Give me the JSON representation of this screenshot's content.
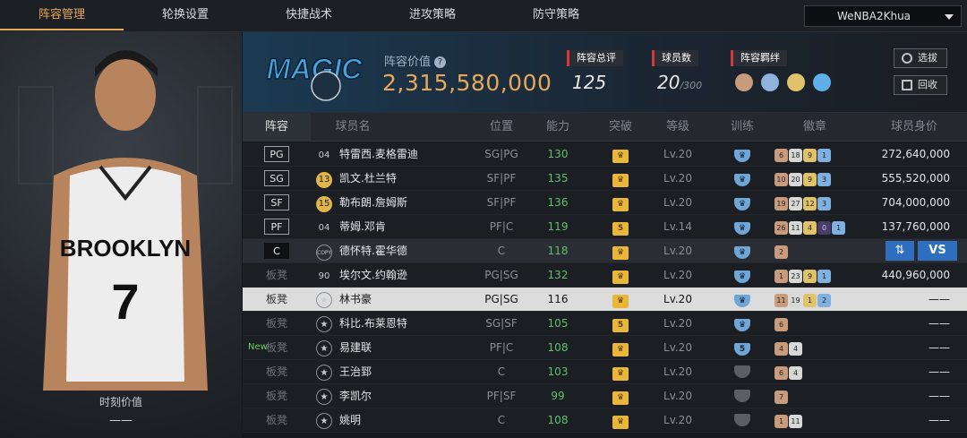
{
  "tabs": [
    {
      "label": "阵容管理",
      "active": true
    },
    {
      "label": "轮换设置",
      "active": false
    },
    {
      "label": "快捷战术",
      "active": false
    },
    {
      "label": "进攻策略",
      "active": false
    },
    {
      "label": "防守策略",
      "active": false
    }
  ],
  "user": {
    "name": "WeNBA2Khua"
  },
  "left_panel": {
    "value_caption": "时刻价值",
    "value": "——"
  },
  "header": {
    "value_caption": "阵容价值",
    "value": "2,315,580,000",
    "overall_label": "阵容总评",
    "overall": "125",
    "count_label": "球员数",
    "count": "20",
    "count_max": "/300",
    "chem_label": "阵容羁绊",
    "select_button": "选拔",
    "recycle_button": "回收"
  },
  "columns": [
    "阵容",
    "球员名",
    "位置",
    "能力",
    "突破",
    "等级",
    "训练",
    "徽章",
    "球员身价"
  ],
  "rows": [
    {
      "slot": "PG",
      "num": "04",
      "name": "特雷西.麦格雷迪",
      "pos": "SG|PG",
      "ability": "130",
      "break": "crown",
      "level": "Lv.20",
      "train": "shield",
      "badges": [
        [
          "b-br",
          "6"
        ],
        [
          "b-si",
          "18"
        ],
        [
          "b-go",
          "9"
        ],
        [
          "b-bl",
          "1"
        ]
      ],
      "value": "272,640,000"
    },
    {
      "slot": "SG",
      "num": "13",
      "name": "凯文.杜兰特",
      "pos": "SF|PF",
      "ability": "135",
      "break": "crown",
      "level": "Lv.20",
      "train": "shield",
      "badges": [
        [
          "b-br",
          "10"
        ],
        [
          "b-si",
          "20"
        ],
        [
          "b-go",
          "9"
        ],
        [
          "b-bl",
          "3"
        ]
      ],
      "value": "555,520,000"
    },
    {
      "slot": "SF",
      "num": "15",
      "name": "勒布朗.詹姆斯",
      "pos": "SF|PF",
      "ability": "136",
      "break": "crown",
      "level": "Lv.20",
      "train": "shield",
      "badges": [
        [
          "b-br",
          "19"
        ],
        [
          "b-si",
          "27"
        ],
        [
          "b-go",
          "12"
        ],
        [
          "b-bl",
          "3"
        ]
      ],
      "value": "704,000,000"
    },
    {
      "slot": "PF",
      "num": "04",
      "name": "蒂姆.邓肯",
      "pos": "PF|C",
      "ability": "119",
      "break": "5",
      "level": "Lv.14",
      "train": "shield",
      "badges": [
        [
          "b-br",
          "26"
        ],
        [
          "b-si",
          "11"
        ],
        [
          "b-go",
          "4"
        ],
        [
          "b-pu",
          "0"
        ],
        [
          "b-bl",
          "1"
        ]
      ],
      "value": "137,760,000"
    },
    {
      "slot": "C",
      "num": "COPY",
      "name": "德怀特.霍华德",
      "pos": "C",
      "ability": "118",
      "break": "crown",
      "level": "Lv.20",
      "train": "shield",
      "badges": [
        [
          "b-br",
          "2"
        ]
      ],
      "value": "",
      "swap": "⇅",
      "vs": "VS"
    },
    {
      "slot": "板凳",
      "num": "90",
      "name": "埃尔文.约翰逊",
      "pos": "PG|SG",
      "ability": "132",
      "break": "crown",
      "level": "Lv.20",
      "train": "shield",
      "badges": [
        [
          "b-br",
          "1"
        ],
        [
          "b-si",
          "23"
        ],
        [
          "b-go",
          "9"
        ],
        [
          "b-bl",
          "1"
        ]
      ],
      "value": "440,960,000"
    },
    {
      "slot": "板凳",
      "num": "star",
      "name": "林书豪",
      "pos": "PG|SG",
      "ability": "116",
      "break": "crown",
      "level": "Lv.20",
      "train": "shield",
      "badges": [
        [
          "b-br",
          "11"
        ],
        [
          "b-si",
          "19"
        ],
        [
          "b-go",
          "1"
        ],
        [
          "b-bl",
          "2"
        ]
      ],
      "value": "——"
    },
    {
      "slot": "板凳",
      "num": "star",
      "name": "科比.布莱恩特",
      "pos": "SG|SF",
      "ability": "105",
      "break": "5",
      "level": "Lv.20",
      "train": "shield",
      "badges": [
        [
          "b-br",
          "6"
        ]
      ],
      "value": "——"
    },
    {
      "slot": "板凳",
      "num": "star",
      "name": "易建联",
      "pos": "PF|C",
      "ability": "108",
      "break": "crown",
      "level": "Lv.20",
      "train": "5",
      "badges": [
        [
          "b-br",
          "4"
        ],
        [
          "b-si",
          "4"
        ]
      ],
      "value": "——",
      "new": "New"
    },
    {
      "slot": "板凳",
      "num": "star",
      "name": "王治郅",
      "pos": "C",
      "ability": "103",
      "break": "crown",
      "level": "Lv.20",
      "train": "gray",
      "badges": [
        [
          "b-br",
          "6"
        ],
        [
          "b-si",
          "4"
        ]
      ],
      "value": "——"
    },
    {
      "slot": "板凳",
      "num": "star",
      "name": "李凯尔",
      "pos": "PF|SF",
      "ability": "99",
      "break": "crown",
      "level": "Lv.20",
      "train": "gray",
      "badges": [
        [
          "b-br",
          "7"
        ]
      ],
      "value": "——"
    },
    {
      "slot": "板凳",
      "num": "star",
      "name": "姚明",
      "pos": "C",
      "ability": "108",
      "break": "crown",
      "level": "Lv.20",
      "train": "gray",
      "badges": [
        [
          "b-br",
          "1"
        ],
        [
          "b-si",
          "11"
        ]
      ],
      "value": "——"
    }
  ]
}
